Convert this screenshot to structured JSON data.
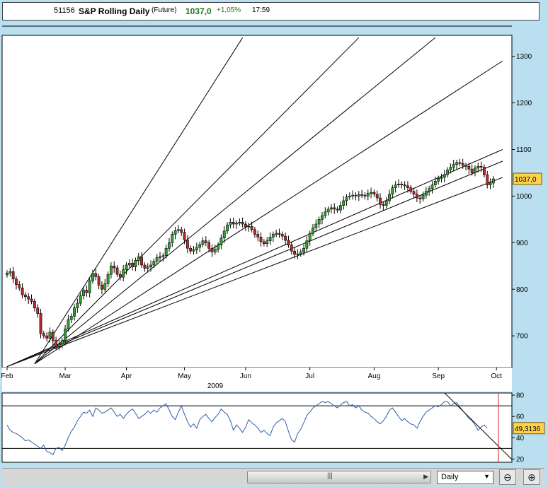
{
  "header": {
    "code": "51156",
    "title": "S&P Rolling Daily",
    "type": "(Future)",
    "price": "1037,0",
    "change": "+1,05%",
    "time": "17:59"
  },
  "chart_data": [
    {
      "type": "candlestick",
      "title": "",
      "x_unit": "trading days since Feb 2009 start",
      "x_labels": [
        "Feb",
        "Mar",
        "Apr",
        "May",
        "Jun",
        "Jul",
        "Aug",
        "Sep",
        "Oct"
      ],
      "x_label_positions": [
        0,
        19,
        39,
        58,
        78,
        99,
        120,
        141,
        160
      ],
      "year_label": "2009",
      "y_ticks": [
        700,
        800,
        900,
        1000,
        1100,
        1200,
        1300
      ],
      "ylim": [
        632,
        1345
      ],
      "last_value_label": "1037,0",
      "grid": false,
      "closes": [
        835,
        838,
        822,
        810,
        803,
        788,
        784,
        779,
        774,
        760,
        748,
        705,
        700,
        695,
        708,
        690,
        677,
        682,
        690,
        715,
        735,
        742,
        760,
        770,
        786,
        798,
        793,
        818,
        834,
        827,
        809,
        800,
        812,
        832,
        850,
        846,
        832,
        826,
        842,
        852,
        856,
        848,
        862,
        870,
        852,
        845,
        848,
        852,
        860,
        868,
        870,
        872,
        888,
        900,
        918,
        926,
        928,
        922,
        906,
        888,
        882,
        885,
        890,
        896,
        904,
        900,
        888,
        880,
        886,
        895,
        910,
        925,
        938,
        944,
        940,
        942,
        944,
        940,
        934,
        935,
        928,
        918,
        912,
        902,
        898,
        904,
        912,
        918,
        920,
        918,
        914,
        905,
        895,
        882,
        875,
        876,
        880,
        888,
        904,
        920,
        932,
        940,
        950,
        958,
        966,
        972,
        975,
        972,
        970,
        980,
        990,
        998,
        1000,
        1002,
        1000,
        1003,
        1002,
        1000,
        1006,
        1008,
        1004,
        996,
        982,
        980,
        990,
        1004,
        1018,
        1024,
        1026,
        1024,
        1022,
        1018,
        1010,
        1004,
        996,
        994,
        1002,
        1010,
        1016,
        1024,
        1032,
        1038,
        1040,
        1046,
        1056,
        1062,
        1068,
        1072,
        1070,
        1066,
        1064,
        1058,
        1050,
        1060,
        1064,
        1062,
        1046,
        1024,
        1028,
        1037
      ],
      "trendlines": [
        {
          "x1": 0,
          "y1": 634,
          "x2": 162,
          "y2": 1040
        },
        {
          "x1": 0,
          "y1": 634,
          "x2": 162,
          "y2": 1075
        },
        {
          "x1": 0,
          "y1": 634,
          "x2": 162,
          "y2": 1100
        },
        {
          "x1": 9,
          "y1": 640,
          "x2": 162,
          "y2": 1290
        },
        {
          "x1": 9,
          "y1": 640,
          "x2": 140,
          "y2": 1340
        },
        {
          "x1": 9,
          "y1": 640,
          "x2": 115,
          "y2": 1340
        },
        {
          "x1": 9,
          "y1": 640,
          "x2": 77,
          "y2": 1340
        }
      ]
    },
    {
      "type": "line",
      "title": "",
      "ylim": [
        17,
        82
      ],
      "y_ticks": [
        20,
        40,
        60,
        80
      ],
      "reference_lines": [
        30,
        70
      ],
      "last_value_label": "49,3136",
      "values": [
        52,
        47,
        45,
        44,
        42,
        40,
        37,
        38,
        36,
        34,
        32,
        30,
        33,
        27,
        26,
        24,
        30,
        31,
        28,
        33,
        40,
        46,
        50,
        56,
        60,
        64,
        63,
        66,
        60,
        68,
        66,
        63,
        64,
        66,
        68,
        64,
        60,
        62,
        58,
        62,
        65,
        67,
        63,
        58,
        60,
        62,
        65,
        63,
        66,
        64,
        68,
        70,
        72,
        66,
        60,
        57,
        64,
        70,
        62,
        55,
        50,
        53,
        49,
        57,
        60,
        62,
        58,
        55,
        59,
        62,
        67,
        64,
        62,
        56,
        47,
        52,
        49,
        45,
        50,
        57,
        54,
        52,
        49,
        45,
        47,
        44,
        42,
        50,
        54,
        56,
        58,
        55,
        46,
        38,
        36,
        44,
        48,
        54,
        61,
        64,
        68,
        70,
        72,
        74,
        73,
        74,
        72,
        70,
        68,
        71,
        73,
        74,
        70,
        71,
        68,
        70,
        66,
        64,
        63,
        60,
        58,
        55,
        53,
        56,
        60,
        66,
        68,
        64,
        60,
        56,
        58,
        55,
        53,
        52,
        49,
        55,
        60,
        64,
        66,
        68,
        70,
        69,
        71,
        74,
        74,
        70,
        72,
        73,
        69,
        65,
        62,
        58,
        56,
        52,
        47,
        50,
        52,
        49
      ]
    }
  ],
  "controls": {
    "period_label": "Daily"
  }
}
